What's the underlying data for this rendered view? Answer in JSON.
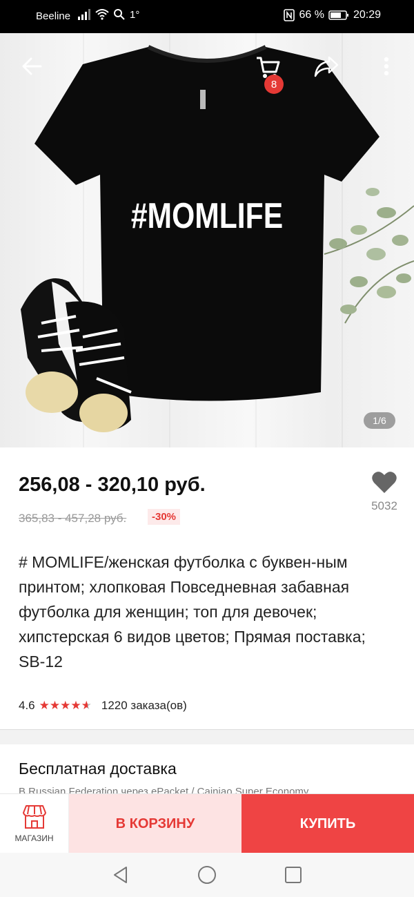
{
  "status_bar": {
    "carrier": "Beeline",
    "temperature": "1°",
    "battery": "66 %",
    "time": "20:29"
  },
  "header": {
    "cart_count": "8"
  },
  "gallery": {
    "print_text": "#MOMLIFE",
    "counter": "1/6"
  },
  "product": {
    "price_range": "256,08 - 320,10 руб.",
    "old_price_range": "365,83 - 457,28 руб.",
    "discount": "-30%",
    "wishlist_count": "5032",
    "title": "# MOMLIFE/женская футболка с буквен-ным принтом; хлопковая Повседневная забавная футболка для женщин; топ для девочек; хипстерская 6 видов цветов; Прямая поставка; SB-12",
    "rating": "4.6",
    "orders": "1220 заказа(ов)"
  },
  "shipping": {
    "title": "Бесплатная доставка",
    "subtitle": "В Russian Federation через ePacket / Cainiao Super Economy"
  },
  "bottom_bar": {
    "store_label": "МАГАЗИН",
    "add_to_cart_label": "В КОРЗИНУ",
    "buy_label": "КУПИТЬ"
  },
  "colors": {
    "accent": "#ef4444",
    "accent_light": "#fde3e3",
    "star": "#e53935"
  }
}
